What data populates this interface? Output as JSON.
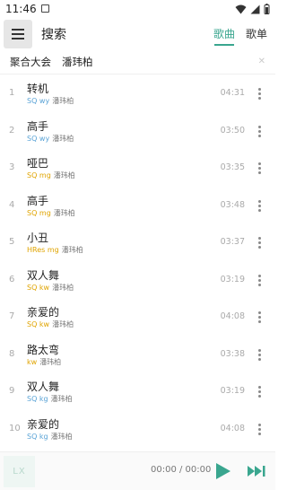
{
  "status_bar": {
    "time": "11:46"
  },
  "app_bar": {
    "title": "搜索",
    "tabs": [
      {
        "label": "歌曲",
        "active": true
      },
      {
        "label": "歌单",
        "active": false
      }
    ]
  },
  "filter": {
    "source": "聚合大会",
    "query": "潘玮柏",
    "clear_icon": "close-icon"
  },
  "songs": [
    {
      "index": "1",
      "title": "转机",
      "source": "SQ wy",
      "artist": "潘玮柏",
      "duration": "04:31"
    },
    {
      "index": "2",
      "title": "高手",
      "source": "SQ wy",
      "artist": "潘玮柏",
      "duration": "03:50"
    },
    {
      "index": "3",
      "title": "哑巴",
      "source": "SQ mg",
      "artist": "潘玮柏",
      "duration": "03:35"
    },
    {
      "index": "4",
      "title": "高手",
      "source": "SQ mg",
      "artist": "潘玮柏",
      "duration": "03:48"
    },
    {
      "index": "5",
      "title": "小丑",
      "source": "HRes mg",
      "artist": "潘玮柏",
      "duration": "03:37"
    },
    {
      "index": "6",
      "title": "双人舞",
      "source": "SQ kw",
      "artist": "潘玮柏",
      "duration": "03:19"
    },
    {
      "index": "7",
      "title": "亲爱的",
      "source": "SQ kw",
      "artist": "潘玮柏",
      "duration": "04:08"
    },
    {
      "index": "8",
      "title": "路太弯",
      "source": "kw",
      "artist": "潘玮柏",
      "duration": "03:38"
    },
    {
      "index": "9",
      "title": "双人舞",
      "source": "SQ kg",
      "artist": "潘玮柏",
      "duration": "03:19"
    },
    {
      "index": "10",
      "title": "亲爱的",
      "source": "SQ kg",
      "artist": "潘玮柏",
      "duration": "04:08"
    }
  ],
  "player": {
    "cover_text": "LX",
    "time": "00:00 / 00:00"
  },
  "colors": {
    "accent": "#3aa68f",
    "quality_sq": "#5aa3d6",
    "quality_kw": "#e0a400"
  }
}
